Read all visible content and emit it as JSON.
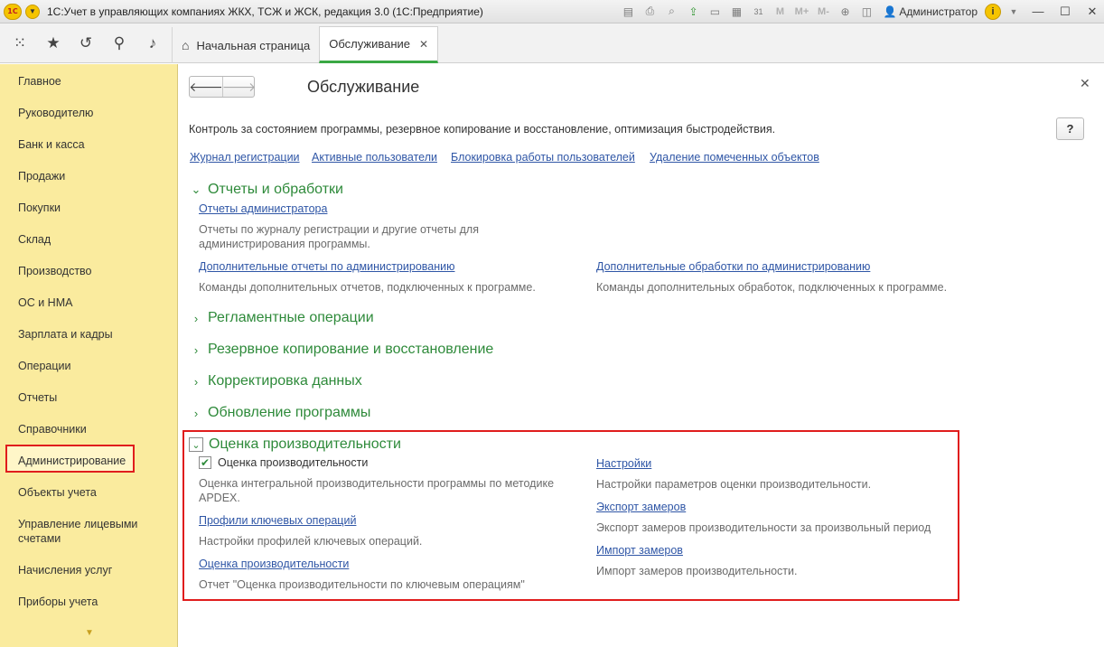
{
  "titlebar": {
    "app_logo": "1С",
    "title": "1С:Учет в управляющих компаниях ЖКХ, ТСЖ и ЖСК, редакция 3.0  (1С:Предприятие)",
    "tools": [
      "save-icon",
      "print-icon",
      "preview-icon",
      "upload-icon",
      "print2-icon",
      "calculator-icon",
      "calendar-icon"
    ],
    "memory_buttons": [
      "M",
      "M+",
      "M-"
    ],
    "user": "Администратор",
    "info": "i"
  },
  "toolbar": {
    "icons": [
      "apps-grid-icon",
      "star-icon",
      "history-icon",
      "search-icon",
      "bell-icon"
    ],
    "tabs": [
      {
        "label": "Начальная страница",
        "icon": "home-icon"
      },
      {
        "label": "Обслуживание"
      }
    ]
  },
  "sidebar": {
    "items": [
      "Главное",
      "Руководителю",
      "Банк и касса",
      "Продажи",
      "Покупки",
      "Склад",
      "Производство",
      "ОС и НМА",
      "Зарплата и кадры",
      "Операции",
      "Отчеты",
      "Справочники",
      "Администрирование",
      "Объекты учета",
      "Управление лицевыми счетами",
      "Начисления услуг",
      "Приборы учета"
    ],
    "selected": "Администрирование"
  },
  "main": {
    "title": "Обслуживание",
    "help": "?",
    "description": "Контроль за состоянием программы, резервное копирование и восстановление, оптимизация быстродействия.",
    "top_links": [
      "Журнал регистрации",
      "Активные пользователи",
      "Блокировка работы пользователей",
      "Удаление помеченных объектов"
    ],
    "reports_section": {
      "title": "Отчеты и обработки",
      "admin_reports_link": "Отчеты администратора",
      "admin_reports_desc_1": "Отчеты по журналу регистрации и другие отчеты для",
      "admin_reports_desc_2": "администрирования программы.",
      "extra_reports_link": "Дополнительные отчеты по администрированию",
      "extra_reports_desc": "Команды дополнительных отчетов, подключенных к программе.",
      "extra_processing_link": "Дополнительные обработки по администрированию",
      "extra_processing_desc": "Команды дополнительных обработок, подключенных к программе."
    },
    "collapsed_sections": [
      "Регламентные операции",
      "Резервное копирование и восстановление",
      "Корректировка данных",
      "Обновление программы"
    ],
    "perf_section": {
      "title": "Оценка производительности",
      "checkbox_label": "Оценка производительности",
      "checkbox_checked": true,
      "checkbox_desc_1": "Оценка интегральной производительности программы по методике",
      "checkbox_desc_2": "APDEX.",
      "profiles_link": "Профили ключевых операций",
      "profiles_desc": "Настройки профилей ключевых операций.",
      "report_link": "Оценка производительности",
      "report_desc": "Отчет \"Оценка производительности по ключевым операциям\"",
      "settings_link": "Настройки",
      "settings_desc": "Настройки параметров оценки производительности.",
      "export_link": "Экспорт замеров",
      "export_desc": "Экспорт замеров производительности за произвольный период",
      "import_link": "Импорт замеров",
      "import_desc": "Импорт замеров производительности."
    }
  }
}
